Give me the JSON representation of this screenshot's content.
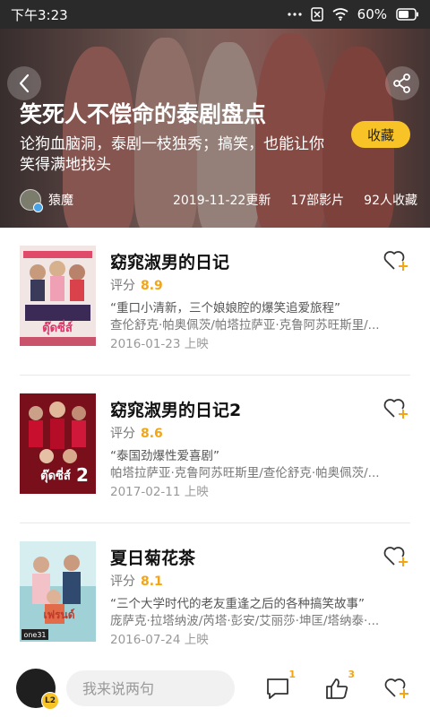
{
  "status_bar": {
    "time": "下午3:23",
    "battery": "60%"
  },
  "hero": {
    "title": "笑死人不偿命的泰剧盘点",
    "description": "论狗血脑洞，泰剧一枝独秀；搞笑，也能让你笑得满地找头",
    "favorite_label": "收藏",
    "author": "猿魔",
    "updated": "2019-11-22更新",
    "film_count": "17部影片",
    "collect_count": "92人收藏"
  },
  "items": [
    {
      "title": "窈窕淑男的日记",
      "rating_label": "评分",
      "score": "8.9",
      "quote": "“重口小清新，三个娘娘腔的爆笑追爱旅程”",
      "cast": "查伦舒克·帕奥佩茨/帕塔拉萨亚·克鲁阿苏旺斯里/...",
      "date": "2016-01-23 上映"
    },
    {
      "title": "窈窕淑男的日记2",
      "rating_label": "评分",
      "score": "8.6",
      "quote": "“泰国劲爆性爱喜剧”",
      "cast": "帕塔拉萨亚·克鲁阿苏旺斯里/查伦舒克·帕奥佩茨/...",
      "date": "2017-02-11 上映"
    },
    {
      "title": "夏日菊花茶",
      "rating_label": "评分",
      "score": "8.1",
      "quote": "“三个大学时代的老友重逢之后的各种搞笑故事”",
      "cast": "庞萨克·拉塔纳波/芮塔·彭安/艾丽莎·坤匡/塔纳泰·...",
      "date": "2016-07-24 上映"
    }
  ],
  "bottom_bar": {
    "level": "L2",
    "comment_placeholder": "我来说两句",
    "comment_count": "1",
    "like_count": "3"
  },
  "colors": {
    "accent": "#f7c327",
    "score": "#f2a517"
  }
}
